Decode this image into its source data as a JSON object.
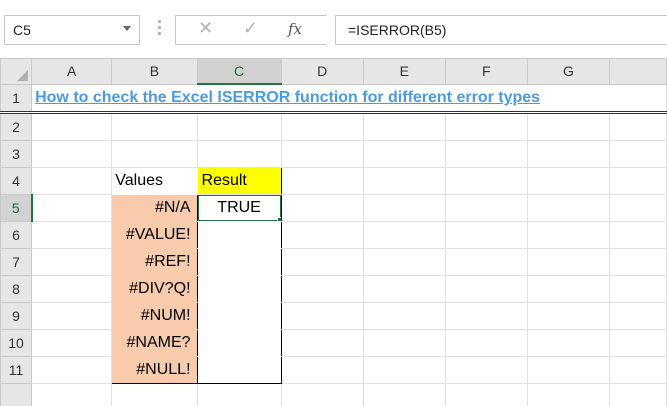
{
  "formula_bar": {
    "name_box": "C5",
    "cancel_icon": "✕",
    "enter_icon": "✓",
    "fx_label": "fx",
    "formula": "=ISERROR(B5)"
  },
  "columns": [
    "A",
    "B",
    "C",
    "D",
    "E",
    "F",
    "G"
  ],
  "rows": [
    "1",
    "2",
    "3",
    "4",
    "5",
    "6",
    "7",
    "8",
    "9",
    "10",
    "11"
  ],
  "title": "How to check the Excel ISERROR function for different error types",
  "table": {
    "header_values": "Values",
    "header_result": "Result",
    "values": [
      "#N/A",
      "#VALUE!",
      "#REF!",
      "#DIV?Q!",
      "#NUM!",
      "#NAME?",
      "#NULL!"
    ],
    "results": [
      "TRUE",
      "",
      "",
      "",
      "",
      "",
      ""
    ]
  },
  "colors": {
    "accent": "#217346",
    "title": "#4a9be0",
    "values_fill": "#f8cbad",
    "result_header_fill": "#ffff00"
  }
}
